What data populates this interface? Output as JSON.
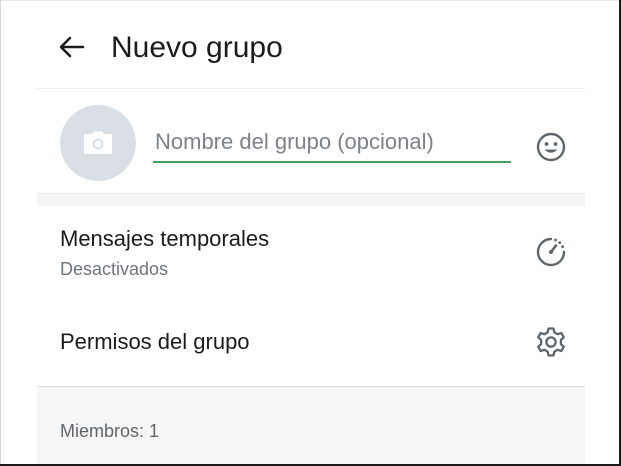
{
  "header": {
    "title": "Nuevo grupo",
    "back_icon": "arrow-left-icon"
  },
  "group_name": {
    "avatar_icon": "camera-icon",
    "placeholder": "Nombre del grupo (opcional)",
    "value": "",
    "emoji_icon": "smiley-icon"
  },
  "settings": {
    "disappearing": {
      "label": "Mensajes temporales",
      "status": "Desactivados",
      "icon": "timer-icon"
    },
    "permissions": {
      "label": "Permisos del grupo",
      "icon": "gear-icon"
    }
  },
  "members": {
    "label": "Miembros: 1"
  },
  "colors": {
    "accent": "#3fa35f",
    "avatar_bg": "#d9dfe5",
    "icon": "#5f666c"
  }
}
